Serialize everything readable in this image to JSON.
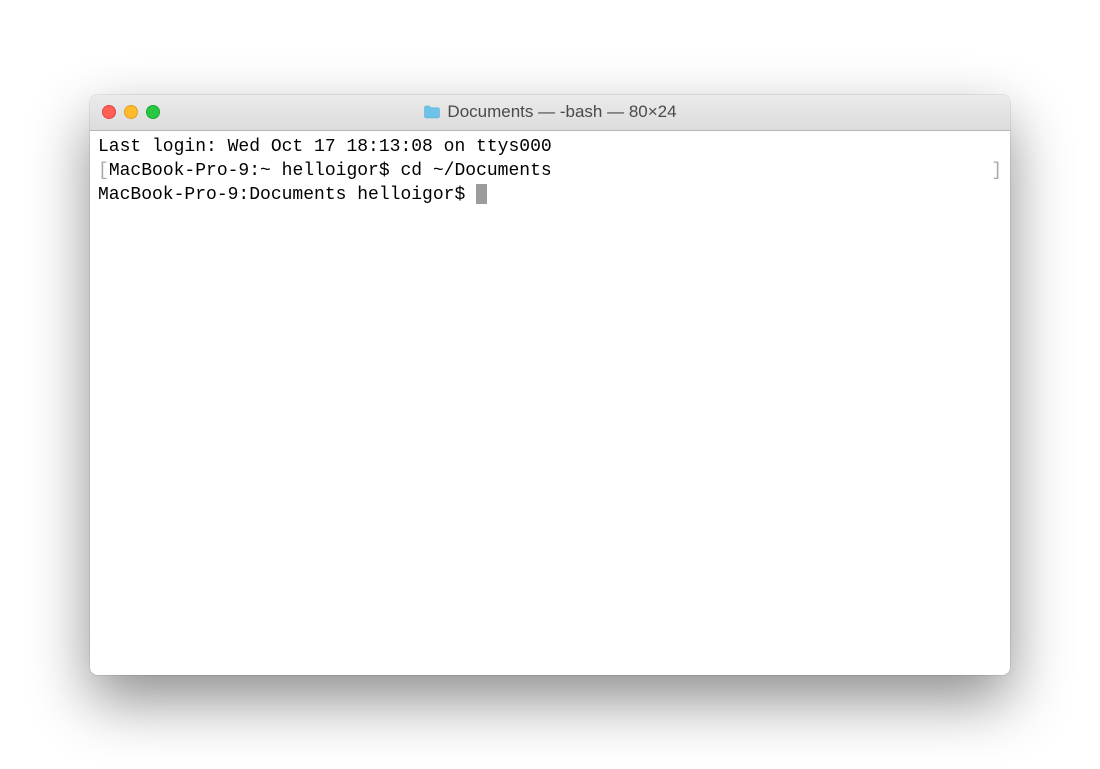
{
  "window": {
    "title": "Documents — -bash — 80×24"
  },
  "terminal": {
    "lines": [
      {
        "bracket_left": "",
        "text": "Last login: Wed Oct 17 18:13:08 on ttys000",
        "bracket_right": ""
      },
      {
        "bracket_left": "[",
        "prompt": "MacBook-Pro-9:~ helloigor$ ",
        "command": "cd ~/Documents",
        "bracket_right": "]"
      },
      {
        "bracket_left": "",
        "prompt": "MacBook-Pro-9:Documents helloigor$ ",
        "command": "",
        "cursor": true,
        "bracket_right": ""
      }
    ]
  }
}
